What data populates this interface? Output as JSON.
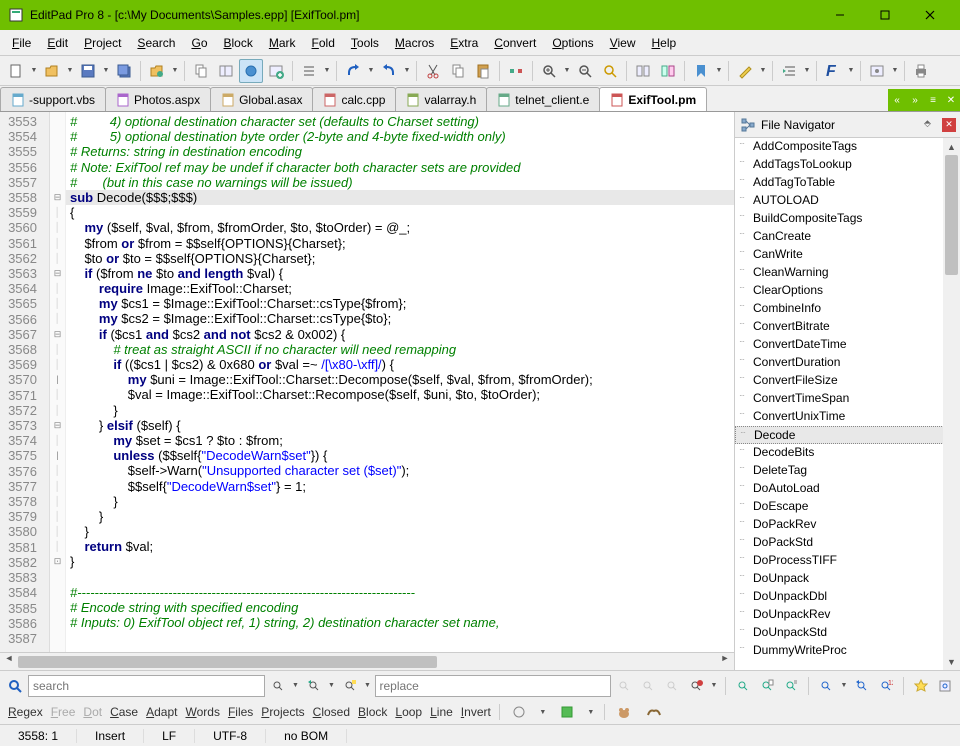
{
  "titlebar": {
    "text": "EditPad Pro 8 - [c:\\My Documents\\Samples.epp] [ExifTool.pm]"
  },
  "menu": [
    "File",
    "Edit",
    "Project",
    "Search",
    "Go",
    "Block",
    "Mark",
    "Fold",
    "Tools",
    "Macros",
    "Extra",
    "Convert",
    "Options",
    "View",
    "Help"
  ],
  "tabs": [
    {
      "label": "-support.vbs",
      "active": false
    },
    {
      "label": "Photos.aspx",
      "active": false
    },
    {
      "label": "Global.asax",
      "active": false
    },
    {
      "label": "calc.cpp",
      "active": false
    },
    {
      "label": "valarray.h",
      "active": false
    },
    {
      "label": "telnet_client.e",
      "active": false
    },
    {
      "label": "ExifTool.pm",
      "active": true
    }
  ],
  "navigator": {
    "title": "File Navigator",
    "items": [
      "AddCompositeTags",
      "AddTagsToLookup",
      "AddTagToTable",
      "AUTOLOAD",
      "BuildCompositeTags",
      "CanCreate",
      "CanWrite",
      "CleanWarning",
      "ClearOptions",
      "CombineInfo",
      "ConvertBitrate",
      "ConvertDateTime",
      "ConvertDuration",
      "ConvertFileSize",
      "ConvertTimeSpan",
      "ConvertUnixTime",
      "Decode",
      "DecodeBits",
      "DeleteTag",
      "DoAutoLoad",
      "DoEscape",
      "DoPackRev",
      "DoPackStd",
      "DoProcessTIFF",
      "DoUnpack",
      "DoUnpackDbl",
      "DoUnpackRev",
      "DoUnpackStd",
      "DummyWriteProc"
    ],
    "active": "Decode"
  },
  "gutter_start": 3553,
  "gutter_count": 35,
  "code": {
    "l1": "#         4) optional destination character set (defaults to Charset setting)",
    "l2": "#         5) optional destination byte order (2-byte and 4-byte fixed-width only)",
    "l3": "# Returns: string in destination encoding",
    "l4": "# Note: ExifTool ref may be undef if character both character sets are provided",
    "l5": "#       (but in this case no warnings will be issued)",
    "l6a": "sub",
    "l6b": " Decode($$$;$$$)",
    "l7": "{",
    "l8a": "    my",
    "l8b": " ($self, $val, $from, $fromOrder, $to, $toOrder) = @_;",
    "l9a": "    $from ",
    "l9b": "or",
    "l9c": " $from = $$self{OPTIONS}{Charset};",
    "l10a": "    $to ",
    "l10b": "or",
    "l10c": " $to = $$self{OPTIONS}{Charset};",
    "l11a": "    if",
    "l11b": " ($from ",
    "l11c": "ne",
    "l11d": " $to ",
    "l11e": "and length",
    "l11f": " $val) {",
    "l12a": "        require",
    "l12b": " Image::ExifTool::Charset;",
    "l13a": "        my",
    "l13b": " $cs1 = $Image::ExifTool::Charset::csType{$from};",
    "l14a": "        my",
    "l14b": " $cs2 = $Image::ExifTool::Charset::csType{$to};",
    "l15a": "        if",
    "l15b": " ($cs1 ",
    "l15c": "and",
    "l15d": " $cs2 ",
    "l15e": "and not",
    "l15f": " $cs2 & 0x002) {",
    "l16": "            # treat as straight ASCII if no character will need remapping",
    "l17a": "            if",
    "l17b": " (($cs1 | $cs2) & 0x680 ",
    "l17c": "or",
    "l17d": " $val =~ ",
    "l17e": "/[\\x80-\\xff]/",
    "l17f": ") {",
    "l18a": "                my",
    "l18b": " $uni = Image::ExifTool::Charset::Decompose($self, $val, $from, $fromOrder);",
    "l19": "                $val = Image::ExifTool::Charset::Recompose($self, $uni, $to, $toOrder);",
    "l20": "            }",
    "l21a": "        } ",
    "l21b": "elsif",
    "l21c": " ($self) {",
    "l22a": "            my",
    "l22b": " $set = $cs1 ? $to : $from;",
    "l23a": "            unless",
    "l23b": " ($$self{",
    "l23c": "\"DecodeWarn$set\"",
    "l23d": "}) {",
    "l24a": "                $self->Warn(",
    "l24b": "\"Unsupported character set ($set)\"",
    "l24c": ");",
    "l25a": "                $$self{",
    "l25b": "\"DecodeWarn$set\"",
    "l25c": "} = 1;",
    "l26": "            }",
    "l27": "        }",
    "l28": "    }",
    "l29a": "    return",
    "l29b": " $val;",
    "l30": "}",
    "l31": "",
    "l32": "#------------------------------------------------------------------------------",
    "l33": "# Encode string with specified encoding",
    "l34": "# Inputs: 0) ExifTool object ref, 1) string, 2) destination character set name,"
  },
  "search": {
    "placeholder": "search",
    "replace_placeholder": "replace"
  },
  "options": [
    "Regex",
    "Free",
    "Dot",
    "Case",
    "Adapt",
    "Words",
    "Files",
    "Projects",
    "Closed",
    "Block",
    "Loop",
    "Line",
    "Invert"
  ],
  "status": {
    "pos": "3558: 1",
    "mode": "Insert",
    "eol": "LF",
    "enc": "UTF-8",
    "bom": "no BOM"
  }
}
